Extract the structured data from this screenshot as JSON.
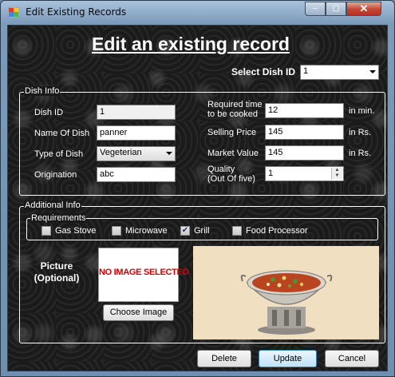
{
  "window": {
    "title": "Edit Existing Records",
    "minimize": "–",
    "maximize": "▢",
    "close": "✕"
  },
  "heading": "Edit an existing record",
  "select": {
    "label": "Select Dish ID",
    "value": "1"
  },
  "dish_info": {
    "legend": "Dish Info",
    "dish_id_label": "Dish ID",
    "dish_id": "1",
    "name_label": "Name Of Dish",
    "name": "panner",
    "type_label": "Type of Dish",
    "type": "Vegeterian",
    "origin_label": "Origination",
    "origin": "abc",
    "time_label_1": "Required time",
    "time_label_2": "to be cooked",
    "time": "12",
    "time_unit": "in min.",
    "price_label": "Selling Price",
    "price": "145",
    "price_unit": "in Rs.",
    "market_label": "Market Value",
    "market": "145",
    "market_unit": "in Rs.",
    "quality_label_1": "Quality",
    "quality_label_2": "(Out Of five)",
    "quality": "1"
  },
  "additional": {
    "legend": "Additional Info",
    "requirements_legend": "Requirements",
    "requirements": [
      {
        "label": "Gas Stove",
        "checked": false
      },
      {
        "label": "Microwave",
        "checked": false
      },
      {
        "label": "Grill",
        "checked": true
      },
      {
        "label": "Food Processor",
        "checked": false
      }
    ],
    "picture_label_1": "Picture",
    "picture_label_2": "(Optional)",
    "no_image_text": "NO IMAGE SELECTED",
    "choose_button": "Choose Image"
  },
  "buttons": {
    "delete": "Delete",
    "update": "Update",
    "cancel": "Cancel"
  },
  "colors": {
    "no_image_text": "#d40000",
    "check_mark": "#1e2f7a",
    "photo_bg": "#f1dfc2"
  }
}
